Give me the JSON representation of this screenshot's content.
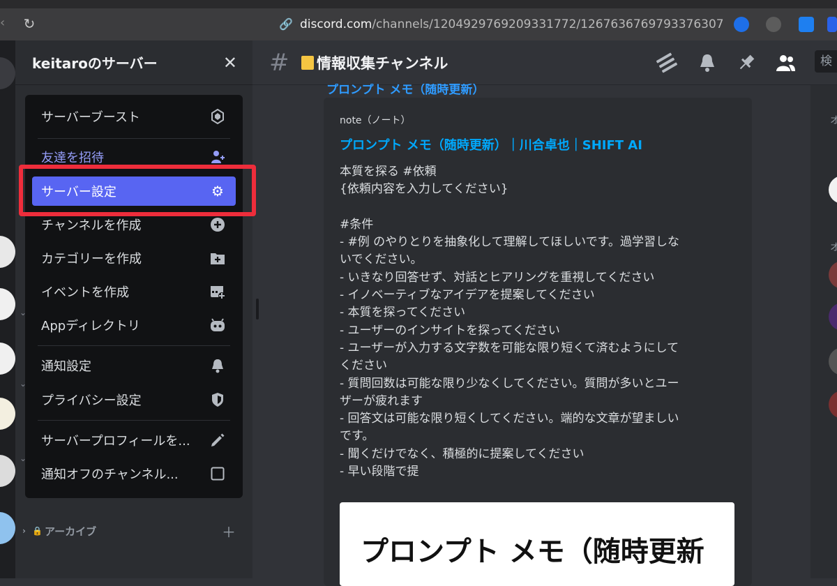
{
  "browser": {
    "url_host": "discord.com",
    "url_path": "/channels/1204929769209331772/1267636769793376307"
  },
  "sidebar": {
    "server_name": "keitaroのサーバー",
    "archive_label": "アーカイブ"
  },
  "menu": {
    "items": [
      {
        "label": "サーバーブースト",
        "icon": "boost-icon"
      },
      {
        "label": "友達を招待",
        "icon": "add-friend-icon"
      },
      {
        "label": "サーバー設定",
        "icon": "gear-icon"
      },
      {
        "label": "チャンネルを作成",
        "icon": "plus-circle-icon"
      },
      {
        "label": "カテゴリーを作成",
        "icon": "folder-plus-icon"
      },
      {
        "label": "イベントを作成",
        "icon": "calendar-plus-icon"
      },
      {
        "label": "Appディレクトリ",
        "icon": "bot-icon"
      },
      {
        "label": "通知設定",
        "icon": "bell-icon"
      },
      {
        "label": "プライバシー設定",
        "icon": "shield-icon"
      },
      {
        "label": "サーバープロフィールを...",
        "icon": "pencil-icon"
      },
      {
        "label": "通知オフのチャンネル...",
        "icon": "checkbox-icon"
      }
    ],
    "accent_color": "#5865f2",
    "highlight_color": "#ee2d3b"
  },
  "channel": {
    "name": "情報収集チャンネル",
    "search_placeholder": "検"
  },
  "message": {
    "cut_link": "プロンプト メモ（随時更新）",
    "embed": {
      "provider": "note（ノート）",
      "title": "プロンプト メモ（随時更新）｜川合卓也｜SHIFT AI",
      "description": "本質を探る #依頼\n{依頼内容を入力してください}\n\n#条件\n- #例 のやりとりを抽象化して理解してほしいです。過学習しな\nいでください。\n- いきなり回答せず、対話とヒアリングを重視してください\n- イノベーティブなアイデアを提案してください\n- 本質を探ってください\n- ユーザーのインサイトを探ってください\n- ユーザーが入力する文字数を可能な限り短くて済むようにして\nください\n- 質問回数は可能な限り少なくしてください。質問が多いとユー\nザーが疲れます\n- 回答文は可能な限り短くしてください。端的な文章が望ましい\nです。\n- 聞くだけでなく、積極的に提案してください\n- 早い段階で提",
      "image_text": "プロンプト メモ（随時更新"
    }
  }
}
